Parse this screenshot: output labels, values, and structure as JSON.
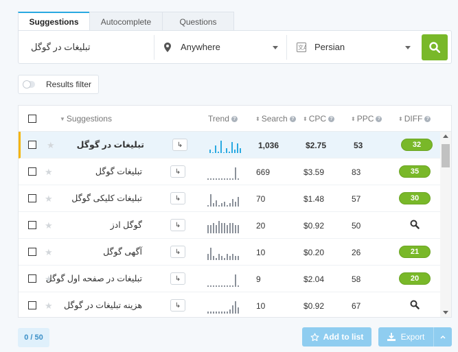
{
  "tabs": [
    {
      "label": "Suggestions",
      "active": true
    },
    {
      "label": "Autocomplete",
      "active": false
    },
    {
      "label": "Questions",
      "active": false
    }
  ],
  "search": {
    "keyword": "تبلیغات در گوگل",
    "location": "Anywhere",
    "language": "Persian"
  },
  "filter": {
    "label": "Results filter"
  },
  "table": {
    "headers": {
      "suggestions": "Suggestions",
      "trend": "Trend",
      "search": "Search",
      "cpc": "CPC",
      "ppc": "PPC",
      "diff": "DIFF"
    },
    "rows": [
      {
        "keyword": "تبلیغات در گوگل",
        "search": "1,036",
        "cpc": "$2.75",
        "ppc": "53",
        "diff": "32",
        "highlighted": true,
        "trend": [
          2,
          0,
          5,
          1,
          8,
          0,
          3,
          1,
          7,
          2,
          6,
          3
        ]
      },
      {
        "keyword": "تبلیغات گوگل",
        "search": "669",
        "cpc": "$3.59",
        "ppc": "83",
        "diff": "35",
        "highlighted": false,
        "trend": [
          1,
          1,
          1,
          1,
          1,
          1,
          1,
          1,
          1,
          1,
          9,
          1
        ]
      },
      {
        "keyword": "تبلیغات کلیکی گوگل",
        "search": "70",
        "cpc": "$1.48",
        "ppc": "57",
        "diff": "30",
        "highlighted": false,
        "trend": [
          1,
          8,
          2,
          4,
          1,
          2,
          3,
          1,
          2,
          5,
          3,
          6
        ]
      },
      {
        "keyword": "گوگل ادز",
        "search": "20",
        "cpc": "$0.92",
        "ppc": "50",
        "diff": "",
        "highlighted": false,
        "trend": [
          4,
          4,
          5,
          4,
          6,
          5,
          5,
          4,
          5,
          5,
          4,
          4
        ]
      },
      {
        "keyword": "آگهی گوگل",
        "search": "10",
        "cpc": "$0.20",
        "ppc": "26",
        "diff": "21",
        "highlighted": false,
        "trend": [
          3,
          6,
          2,
          1,
          3,
          2,
          1,
          3,
          2,
          3,
          2,
          2
        ]
      },
      {
        "keyword": "تبلیغات در صفحه اول گوگل",
        "search": "9",
        "cpc": "$2.04",
        "ppc": "58",
        "diff": "20",
        "highlighted": false,
        "trend": [
          1,
          1,
          1,
          1,
          1,
          1,
          1,
          1,
          1,
          1,
          9,
          1
        ]
      },
      {
        "keyword": "هزینه تبلیغات در گوگل",
        "search": "10",
        "cpc": "$0.92",
        "ppc": "67",
        "diff": "",
        "highlighted": false,
        "trend": [
          1,
          1,
          1,
          1,
          1,
          1,
          1,
          1,
          2,
          4,
          6,
          3
        ]
      }
    ]
  },
  "footer": {
    "counter": "0 / 50",
    "add_to_list": "Add to list",
    "export": "Export"
  },
  "colors": {
    "accent_green": "#79b829",
    "accent_blue": "#29a9e1",
    "highlight_bar": "#f5b400",
    "button_blue": "#8fcdf0"
  }
}
